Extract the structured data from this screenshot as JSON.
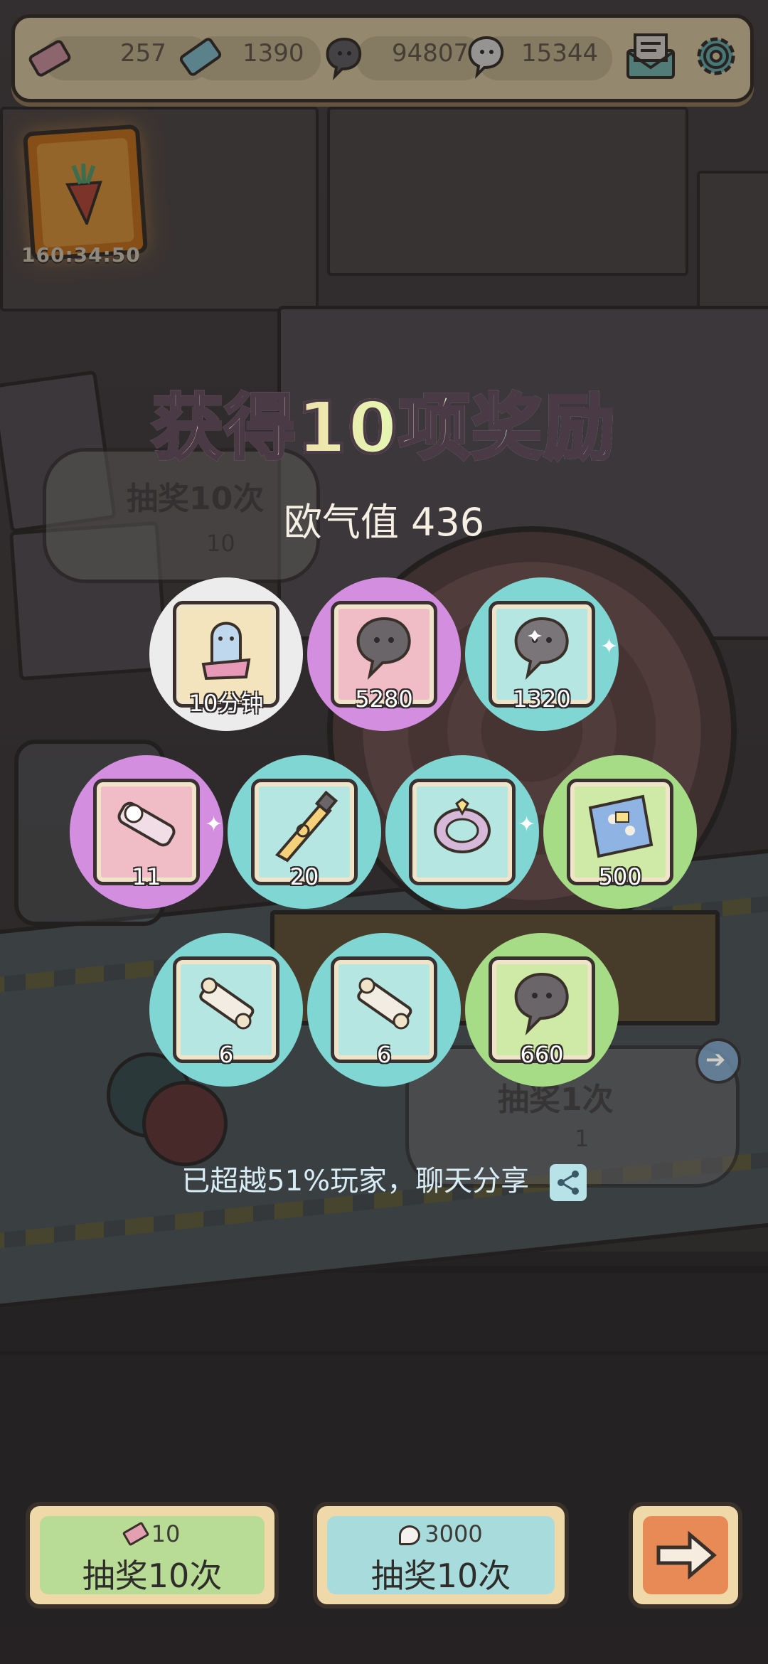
{
  "resources": {
    "ticket_pink": "257",
    "ticket_blue": "1390",
    "soul_dark": "94807",
    "soul_light": "15344"
  },
  "event": {
    "timer": "160:34:50"
  },
  "background": {
    "left_draw_label": "抽奖10次",
    "left_draw_cost": "10",
    "right_draw_label": "抽奖1次",
    "right_draw_cost": "1"
  },
  "result": {
    "title": "获得10项奖励",
    "luck_label": "欧气值 436",
    "share_text": "已超越51%玩家，聊天分享"
  },
  "rewards": [
    {
      "qty": "10分钟",
      "rarity": "white",
      "icon": "ghost-costume-icon"
    },
    {
      "qty": "5280",
      "rarity": "purple",
      "icon": "dark-soul-icon"
    },
    {
      "qty": "1320",
      "rarity": "cyan",
      "icon": "dark-soul-icon"
    },
    {
      "qty": "11",
      "rarity": "purple",
      "icon": "scroll-tube-icon"
    },
    {
      "qty": "20",
      "rarity": "cyan",
      "icon": "paint-tube-icon"
    },
    {
      "qty": "",
      "rarity": "cyan",
      "icon": "ring-gem-icon"
    },
    {
      "qty": "500",
      "rarity": "green",
      "icon": "blueprint-icon"
    },
    {
      "qty": "6",
      "rarity": "cyan",
      "icon": "scroll-icon"
    },
    {
      "qty": "6",
      "rarity": "cyan",
      "icon": "scroll-icon"
    },
    {
      "qty": "660",
      "rarity": "green",
      "icon": "dark-soul-icon"
    }
  ],
  "buttons": {
    "draw_ticket": {
      "cost": "10",
      "label": "抽奖10次"
    },
    "draw_soul": {
      "cost": "3000",
      "label": "抽奖10次"
    },
    "next": {
      "icon": "arrow-right-icon"
    }
  },
  "colors": {
    "white": "#ececec",
    "purple": "#d48ee0",
    "cyan": "#7fd6d2",
    "green": "#a7dc86",
    "card_pink": "#f0bcc6",
    "card_cyan": "#b5e6e2",
    "card_green": "#cfe9a6",
    "card_cream": "#f3e4bd"
  }
}
